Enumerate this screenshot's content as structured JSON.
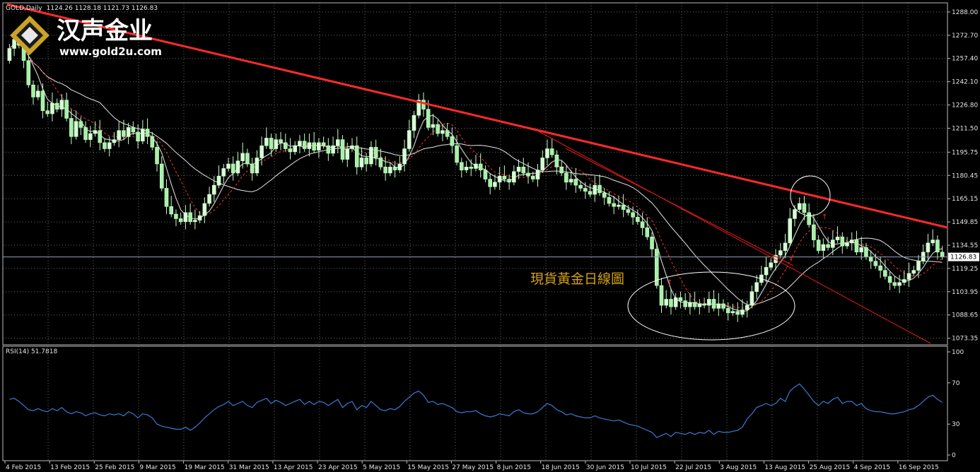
{
  "header": {
    "symbol": "GOLD,Daily",
    "ohlc": "1124.26 1128.18 1121.73 1126.83",
    "rsi_label": "RSI(14) 51.7818"
  },
  "logo": {
    "name_cn": "汉声金业",
    "url": "www.gold2u.com"
  },
  "annotation": {
    "text": "現貨黃金日線圖"
  },
  "colors": {
    "background": "#000000",
    "grid": "#5a6e5a",
    "bull": "#d7ffd7",
    "bull_edge": "#c8ffc8",
    "bear": "#a8f0a8",
    "wick": "#c8ffc8",
    "ma_fast": "#c8c8c8",
    "ma_slow": "#e6e6e6",
    "ma_dash": "#ff3232",
    "trendline": "#ff2a2a",
    "channel": "#e61919",
    "rsi": "#3a7bd5",
    "current_price": "#8fa3b8"
  },
  "chart_data": [
    {
      "type": "candlestick",
      "title": "GOLD,Daily",
      "y_ticks": [
        "1288.00",
        "1272.70",
        "1257.40",
        "1242.10",
        "1226.80",
        "1211.50",
        "1195.75",
        "1180.45",
        "1165.15",
        "1149.85",
        "1134.55",
        "1119.25",
        "1103.95",
        "1088.65",
        "1073.35"
      ],
      "current_price": "1126.83",
      "x_ticks": [
        "4 Feb 2015",
        "13 Feb 2015",
        "25 Feb 2015",
        "9 Mar 2015",
        "19 Mar 2015",
        "31 Mar 2015",
        "13 Apr 2015",
        "23 Apr 2015",
        "5 May 2015",
        "15 May 2015",
        "27 May 2015",
        "8 Jun 2015",
        "18 Jun 2015",
        "30 Jun 2015",
        "10 Jul 2015",
        "22 Jul 2015",
        "3 Aug 2015",
        "13 Aug 2015",
        "25 Aug 2015",
        "4 Sep 2015",
        "16 Sep 2015"
      ],
      "ylim": [
        1069,
        1294
      ],
      "close": [
        1264,
        1270,
        1266,
        1256,
        1240,
        1232,
        1236,
        1223,
        1221,
        1228,
        1224,
        1230,
        1218,
        1206,
        1216,
        1212,
        1204,
        1208,
        1210,
        1202,
        1198,
        1202,
        1204,
        1210,
        1206,
        1212,
        1209,
        1203,
        1211,
        1206,
        1199,
        1188,
        1172,
        1160,
        1155,
        1152,
        1150,
        1156,
        1150,
        1151,
        1154,
        1162,
        1168,
        1174,
        1180,
        1185,
        1188,
        1182,
        1190,
        1195,
        1188,
        1182,
        1192,
        1200,
        1205,
        1198,
        1204,
        1202,
        1198,
        1196,
        1200,
        1203,
        1198,
        1202,
        1197,
        1202,
        1200,
        1195,
        1200,
        1204,
        1191,
        1198,
        1200,
        1186,
        1192,
        1188,
        1199,
        1192,
        1186,
        1182,
        1186,
        1184,
        1188,
        1198,
        1210,
        1220,
        1230,
        1224,
        1212,
        1214,
        1208,
        1210,
        1206,
        1200,
        1189,
        1184,
        1186,
        1185,
        1188,
        1184,
        1178,
        1173,
        1176,
        1180,
        1178,
        1176,
        1183,
        1186,
        1182,
        1180,
        1178,
        1184,
        1192,
        1198,
        1194,
        1186,
        1182,
        1176,
        1178,
        1174,
        1172,
        1170,
        1168,
        1174,
        1169,
        1166,
        1162,
        1160,
        1161,
        1158,
        1156,
        1153,
        1150,
        1146,
        1140,
        1132,
        1108,
        1095,
        1099,
        1094,
        1100,
        1098,
        1094,
        1097,
        1094,
        1096,
        1095,
        1099,
        1093,
        1096,
        1093,
        1090,
        1091,
        1089,
        1092,
        1095,
        1104,
        1110,
        1115,
        1120,
        1123,
        1128,
        1131,
        1136,
        1152,
        1158,
        1162,
        1156,
        1148,
        1138,
        1131,
        1135,
        1133,
        1138,
        1140,
        1134,
        1136,
        1138,
        1130,
        1133,
        1127,
        1124,
        1121,
        1118,
        1114,
        1110,
        1108,
        1110,
        1112,
        1116,
        1118,
        1124,
        1130,
        1136,
        1138,
        1130,
        1127
      ],
      "rsi": {
        "title": "RSI(14) 51.7818",
        "value": 51.7818,
        "y_ticks": [
          "100",
          "70",
          "30",
          "0"
        ],
        "ylim": [
          0,
          100
        ],
        "values": [
          54,
          55,
          52,
          48,
          44,
          43,
          45,
          43,
          42,
          45,
          43,
          46,
          42,
          40,
          42,
          41,
          38,
          40,
          41,
          39,
          38,
          40,
          39,
          40,
          38,
          42,
          40,
          36,
          40,
          39,
          36,
          30,
          28,
          27,
          26,
          25,
          25,
          27,
          24,
          27,
          31,
          36,
          40,
          44,
          47,
          49,
          52,
          48,
          50,
          52,
          48,
          46,
          51,
          53,
          55,
          50,
          53,
          51,
          48,
          50,
          52,
          54,
          49,
          52,
          49,
          52,
          51,
          48,
          51,
          54,
          46,
          50,
          52,
          44,
          48,
          46,
          52,
          48,
          44,
          43,
          45,
          44,
          47,
          52,
          56,
          60,
          62,
          58,
          51,
          52,
          49,
          50,
          48,
          46,
          42,
          41,
          42,
          42,
          43,
          40,
          38,
          37,
          38,
          40,
          39,
          38,
          42,
          44,
          41,
          40,
          40,
          42,
          46,
          50,
          48,
          44,
          42,
          39,
          40,
          38,
          37,
          36,
          36,
          38,
          36,
          35,
          34,
          33,
          34,
          32,
          30,
          29,
          28,
          26,
          24,
          22,
          17,
          19,
          21,
          18,
          22,
          21,
          20,
          22,
          20,
          22,
          21,
          24,
          20,
          23,
          22,
          22,
          23,
          24,
          27,
          35,
          40,
          46,
          48,
          50,
          48,
          50,
          55,
          52,
          62,
          66,
          69,
          64,
          58,
          52,
          48,
          52,
          50,
          54,
          56,
          50,
          52,
          52,
          48,
          50,
          45,
          43,
          42,
          42,
          41,
          40,
          40,
          41,
          42,
          44,
          45,
          48,
          52,
          56,
          58,
          54,
          51
        ]
      }
    }
  ]
}
